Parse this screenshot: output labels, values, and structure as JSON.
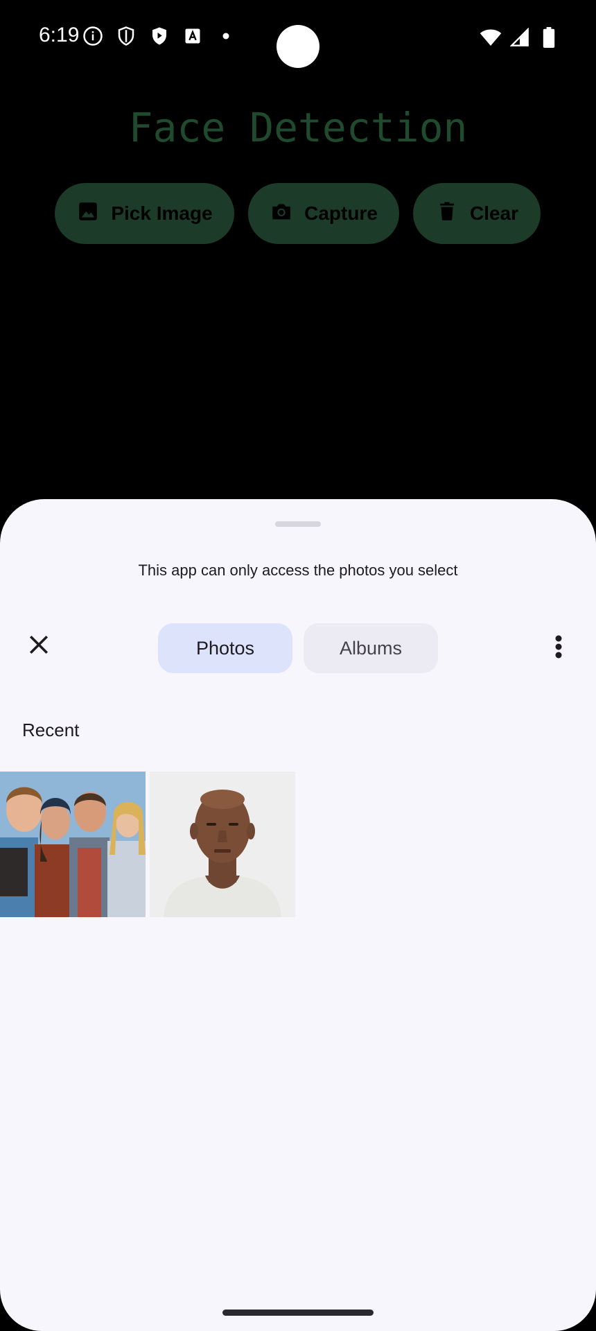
{
  "status_bar": {
    "time": "6:19",
    "left_icons": [
      "info-icon",
      "shield-icon",
      "play-protect-icon",
      "translate-icon",
      "dot-icon"
    ],
    "right_icons": [
      "wifi-icon",
      "signal-icon",
      "battery-icon"
    ]
  },
  "app": {
    "title": "Face Detection",
    "buttons": [
      {
        "label": "Pick Image",
        "icon": "image-icon"
      },
      {
        "label": "Capture",
        "icon": "camera-icon"
      },
      {
        "label": "Clear",
        "icon": "trash-icon"
      }
    ],
    "accent_color": "#1c3b28",
    "title_color": "#1f4a2e"
  },
  "picker": {
    "message": "This app can only access the photos you select",
    "tabs": [
      {
        "label": "Photos",
        "selected": true
      },
      {
        "label": "Albums",
        "selected": false
      }
    ],
    "section_title": "Recent",
    "photos": [
      {
        "description": "group-photo"
      },
      {
        "description": "portrait-photo"
      }
    ],
    "selected_tab_color": "#dde3fb"
  }
}
